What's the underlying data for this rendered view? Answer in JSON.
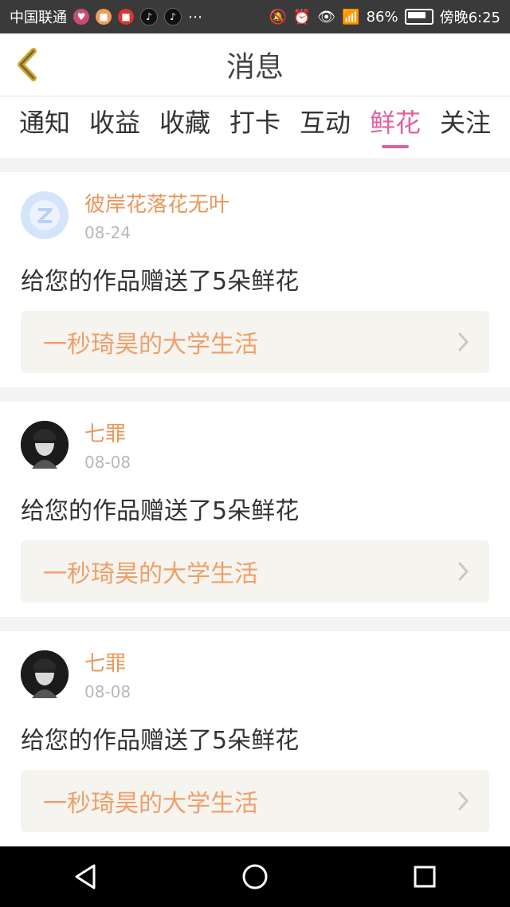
{
  "status_bar": {
    "carrier": "中国联通",
    "right_text": "86%",
    "time": "傍晚6:25"
  },
  "header": {
    "title": "消息"
  },
  "tabs": [
    {
      "label": "通知"
    },
    {
      "label": "收益"
    },
    {
      "label": "收藏"
    },
    {
      "label": "打卡"
    },
    {
      "label": "互动"
    },
    {
      "label": "鲜花"
    },
    {
      "label": "关注"
    }
  ],
  "active_tab": "鲜花",
  "colors": {
    "accent": "#e0629d",
    "username": "#e9975c",
    "work_title": "#ef9f6b"
  },
  "items": [
    {
      "username": "彼岸花落花无叶",
      "date": "08-24",
      "message": "给您的作品赠送了5朵鲜花",
      "work_title": "一秒琦昊的大学生活"
    },
    {
      "username": "七罪",
      "date": "08-08",
      "message": "给您的作品赠送了5朵鲜花",
      "work_title": "一秒琦昊的大学生活"
    },
    {
      "username": "七罪",
      "date": "08-08",
      "message": "给您的作品赠送了5朵鲜花",
      "work_title": "一秒琦昊的大学生活"
    }
  ]
}
